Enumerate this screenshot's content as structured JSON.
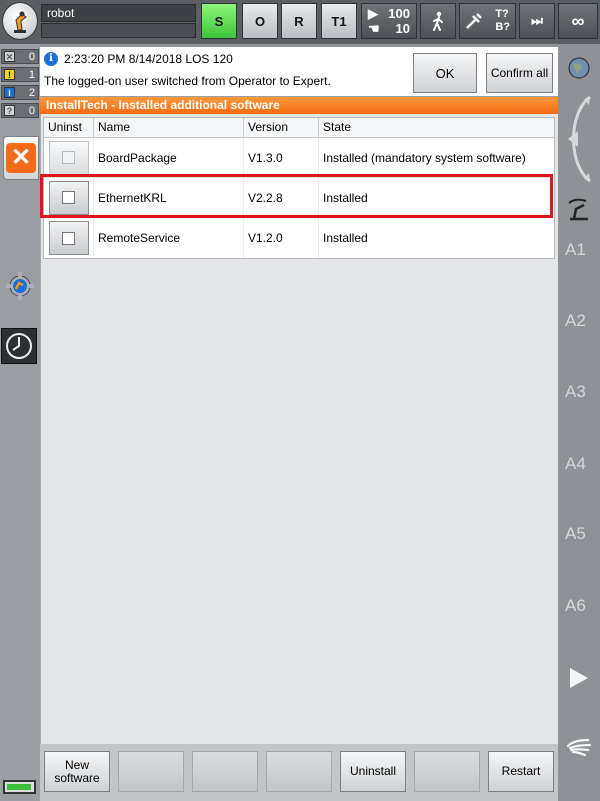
{
  "header": {
    "robot_name": "robot",
    "mode_buttons": [
      "S",
      "O",
      "R",
      "T1"
    ],
    "override_program": "100",
    "override_jog": "10",
    "tool_labels": [
      "T?",
      "B?"
    ],
    "infinity_label": "∞"
  },
  "messages": {
    "counts": [
      {
        "type": "acknowledge",
        "count": "0"
      },
      {
        "type": "warning",
        "count": "1"
      },
      {
        "type": "info",
        "count": "2"
      },
      {
        "type": "dialog",
        "count": "0"
      }
    ],
    "current": {
      "timestamp": "2:23:20 PM 8/14/2018 LOS 120",
      "text": "The logged-on user switched from Operator to Expert.",
      "ok_label": "OK",
      "confirm_all_label": "Confirm all"
    }
  },
  "window": {
    "title": "InstallTech - Installed additional software"
  },
  "table": {
    "columns": [
      "Uninst",
      "Name",
      "Version",
      "State"
    ],
    "rows": [
      {
        "name": "BoardPackage",
        "version": "V1.3.0",
        "state": "Installed (mandatory system software)"
      },
      {
        "name": "EthernetKRL",
        "version": "V2.2.8",
        "state": "Installed"
      },
      {
        "name": "RemoteService",
        "version": "V1.2.0",
        "state": "Installed"
      }
    ]
  },
  "softkeys": {
    "new_software": "New software",
    "uninstall": "Uninstall",
    "restart": "Restart"
  },
  "axes": [
    "A1",
    "A2",
    "A3",
    "A4",
    "A5",
    "A6"
  ],
  "colors": {
    "accent_orange": "#f26b10",
    "highlight_red": "#e0141e",
    "mode_green": "#3ec43a"
  }
}
